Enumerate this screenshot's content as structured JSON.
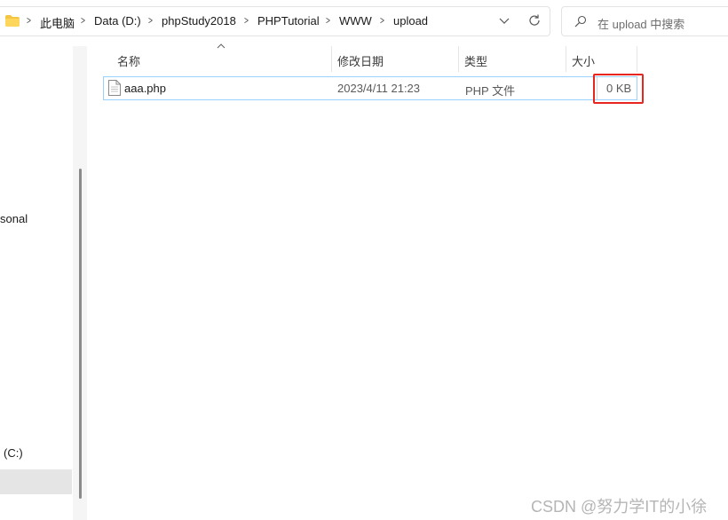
{
  "address_bar": {
    "breadcrumbs": [
      "此电脑",
      "Data (D:)",
      "phpStudy2018",
      "PHPTutorial",
      "WWW",
      "upload"
    ]
  },
  "search": {
    "placeholder": "在 upload 中搜索"
  },
  "nav_pane": {
    "items": [
      {
        "label": "sonal"
      },
      {
        "label": "(C:)"
      }
    ]
  },
  "columns": {
    "name": "名称",
    "modified": "修改日期",
    "type": "类型",
    "size": "大小"
  },
  "files": [
    {
      "name": "aaa.php",
      "modified": "2023/4/11 21:23",
      "type": "PHP 文件",
      "size": "0 KB"
    }
  ],
  "watermark": "CSDN @努力学IT的小徐",
  "colors": {
    "selection_border": "#99d1ff",
    "annotation": "#e8251e",
    "folder": "#f4c542"
  }
}
